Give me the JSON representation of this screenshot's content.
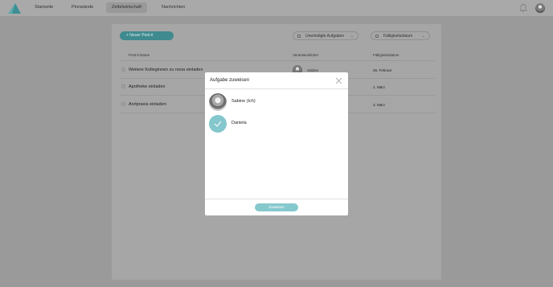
{
  "nav": {
    "items": [
      {
        "label": "Startseite",
        "active": false
      },
      {
        "label": "Pinnwände",
        "active": false
      },
      {
        "label": "Zettelwirtschaft",
        "active": true
      },
      {
        "label": "Nachrichten",
        "active": false
      }
    ],
    "icons": {
      "logo": "logo-icon",
      "bell": "bell-icon",
      "avatar": "user-avatar"
    }
  },
  "toolbar": {
    "new_button": "+ Neuer Post-it",
    "filter_open": "Unerledigte Aufgaben",
    "filter_sort": "Fälligkeitsdatum"
  },
  "table": {
    "headers": {
      "name": "Post-it Name",
      "owner": "Verantwortlicher",
      "due": "Fälligkeitsdatum"
    },
    "rows": [
      {
        "name": "Weitere Kolleginnen zu nooa einladen",
        "owner": "Sabine",
        "due": "26. Februar"
      },
      {
        "name": "Apotheke einladen",
        "owner": "",
        "due": "1. März"
      },
      {
        "name": "Arztpraxis einladen",
        "owner": "",
        "due": "3. März"
      }
    ]
  },
  "modal": {
    "title": "Aufgabe zuweisen",
    "close_icon": "close-icon",
    "people": [
      {
        "name": "Sabine (Ich)",
        "selected": false
      },
      {
        "name": "Daniela",
        "selected": true
      }
    ],
    "assign_button": "Zuweisen"
  },
  "colors": {
    "accent": "#86c9cd",
    "accent_dark": "#3f8a8f",
    "overlay": "#9a9a9a",
    "modal_bg": "#ffffff"
  }
}
